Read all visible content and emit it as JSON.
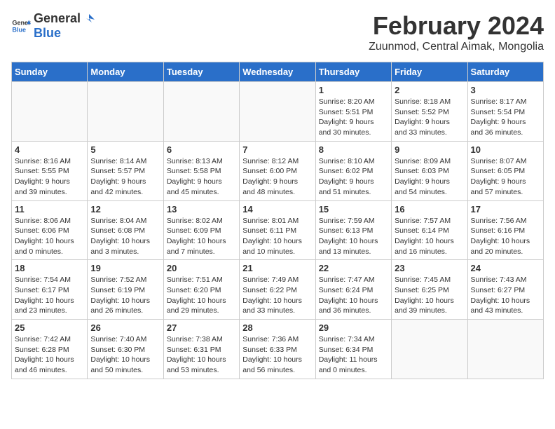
{
  "header": {
    "logo_general": "General",
    "logo_blue": "Blue",
    "month_year": "February 2024",
    "location": "Zuunmod, Central Aimak, Mongolia"
  },
  "days_of_week": [
    "Sunday",
    "Monday",
    "Tuesday",
    "Wednesday",
    "Thursday",
    "Friday",
    "Saturday"
  ],
  "weeks": [
    [
      {
        "day": "",
        "info": ""
      },
      {
        "day": "",
        "info": ""
      },
      {
        "day": "",
        "info": ""
      },
      {
        "day": "",
        "info": ""
      },
      {
        "day": "1",
        "info": "Sunrise: 8:20 AM\nSunset: 5:51 PM\nDaylight: 9 hours\nand 30 minutes."
      },
      {
        "day": "2",
        "info": "Sunrise: 8:18 AM\nSunset: 5:52 PM\nDaylight: 9 hours\nand 33 minutes."
      },
      {
        "day": "3",
        "info": "Sunrise: 8:17 AM\nSunset: 5:54 PM\nDaylight: 9 hours\nand 36 minutes."
      }
    ],
    [
      {
        "day": "4",
        "info": "Sunrise: 8:16 AM\nSunset: 5:55 PM\nDaylight: 9 hours\nand 39 minutes."
      },
      {
        "day": "5",
        "info": "Sunrise: 8:14 AM\nSunset: 5:57 PM\nDaylight: 9 hours\nand 42 minutes."
      },
      {
        "day": "6",
        "info": "Sunrise: 8:13 AM\nSunset: 5:58 PM\nDaylight: 9 hours\nand 45 minutes."
      },
      {
        "day": "7",
        "info": "Sunrise: 8:12 AM\nSunset: 6:00 PM\nDaylight: 9 hours\nand 48 minutes."
      },
      {
        "day": "8",
        "info": "Sunrise: 8:10 AM\nSunset: 6:02 PM\nDaylight: 9 hours\nand 51 minutes."
      },
      {
        "day": "9",
        "info": "Sunrise: 8:09 AM\nSunset: 6:03 PM\nDaylight: 9 hours\nand 54 minutes."
      },
      {
        "day": "10",
        "info": "Sunrise: 8:07 AM\nSunset: 6:05 PM\nDaylight: 9 hours\nand 57 minutes."
      }
    ],
    [
      {
        "day": "11",
        "info": "Sunrise: 8:06 AM\nSunset: 6:06 PM\nDaylight: 10 hours\nand 0 minutes."
      },
      {
        "day": "12",
        "info": "Sunrise: 8:04 AM\nSunset: 6:08 PM\nDaylight: 10 hours\nand 3 minutes."
      },
      {
        "day": "13",
        "info": "Sunrise: 8:02 AM\nSunset: 6:09 PM\nDaylight: 10 hours\nand 7 minutes."
      },
      {
        "day": "14",
        "info": "Sunrise: 8:01 AM\nSunset: 6:11 PM\nDaylight: 10 hours\nand 10 minutes."
      },
      {
        "day": "15",
        "info": "Sunrise: 7:59 AM\nSunset: 6:13 PM\nDaylight: 10 hours\nand 13 minutes."
      },
      {
        "day": "16",
        "info": "Sunrise: 7:57 AM\nSunset: 6:14 PM\nDaylight: 10 hours\nand 16 minutes."
      },
      {
        "day": "17",
        "info": "Sunrise: 7:56 AM\nSunset: 6:16 PM\nDaylight: 10 hours\nand 20 minutes."
      }
    ],
    [
      {
        "day": "18",
        "info": "Sunrise: 7:54 AM\nSunset: 6:17 PM\nDaylight: 10 hours\nand 23 minutes."
      },
      {
        "day": "19",
        "info": "Sunrise: 7:52 AM\nSunset: 6:19 PM\nDaylight: 10 hours\nand 26 minutes."
      },
      {
        "day": "20",
        "info": "Sunrise: 7:51 AM\nSunset: 6:20 PM\nDaylight: 10 hours\nand 29 minutes."
      },
      {
        "day": "21",
        "info": "Sunrise: 7:49 AM\nSunset: 6:22 PM\nDaylight: 10 hours\nand 33 minutes."
      },
      {
        "day": "22",
        "info": "Sunrise: 7:47 AM\nSunset: 6:24 PM\nDaylight: 10 hours\nand 36 minutes."
      },
      {
        "day": "23",
        "info": "Sunrise: 7:45 AM\nSunset: 6:25 PM\nDaylight: 10 hours\nand 39 minutes."
      },
      {
        "day": "24",
        "info": "Sunrise: 7:43 AM\nSunset: 6:27 PM\nDaylight: 10 hours\nand 43 minutes."
      }
    ],
    [
      {
        "day": "25",
        "info": "Sunrise: 7:42 AM\nSunset: 6:28 PM\nDaylight: 10 hours\nand 46 minutes."
      },
      {
        "day": "26",
        "info": "Sunrise: 7:40 AM\nSunset: 6:30 PM\nDaylight: 10 hours\nand 50 minutes."
      },
      {
        "day": "27",
        "info": "Sunrise: 7:38 AM\nSunset: 6:31 PM\nDaylight: 10 hours\nand 53 minutes."
      },
      {
        "day": "28",
        "info": "Sunrise: 7:36 AM\nSunset: 6:33 PM\nDaylight: 10 hours\nand 56 minutes."
      },
      {
        "day": "29",
        "info": "Sunrise: 7:34 AM\nSunset: 6:34 PM\nDaylight: 11 hours\nand 0 minutes."
      },
      {
        "day": "",
        "info": ""
      },
      {
        "day": "",
        "info": ""
      }
    ]
  ]
}
